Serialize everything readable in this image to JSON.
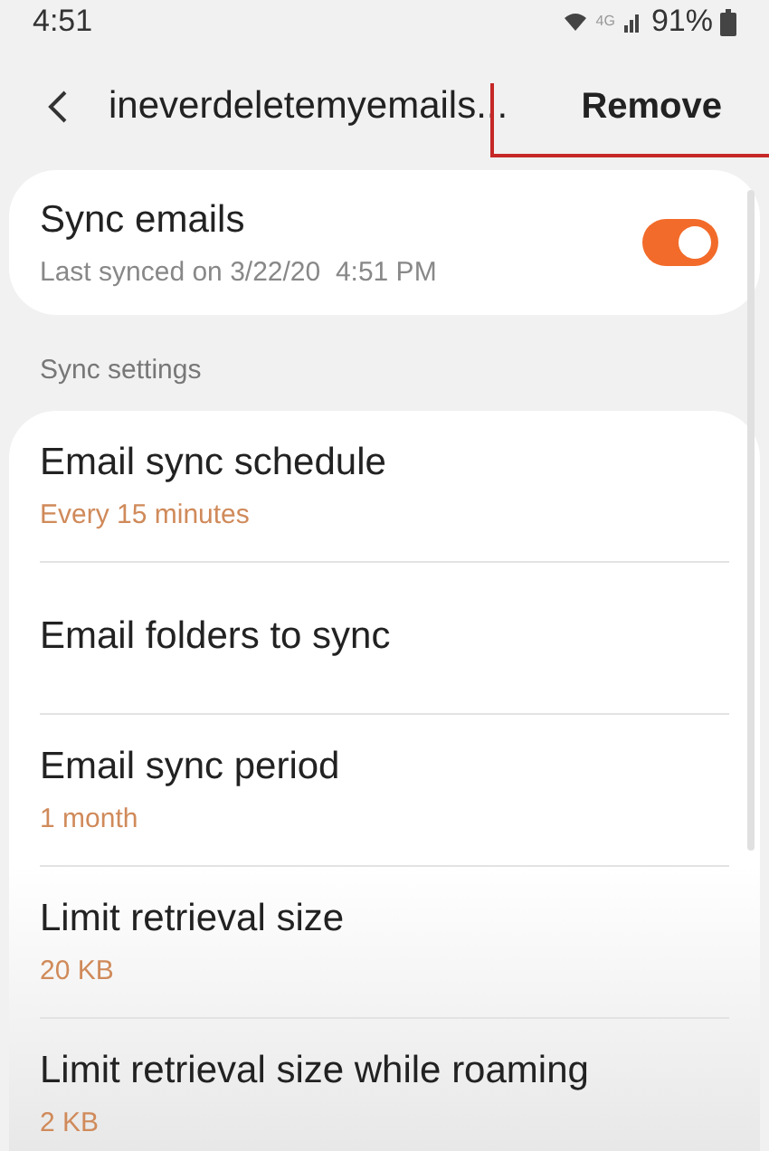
{
  "status_bar": {
    "time": "4:51",
    "network": "4G",
    "battery": "91%"
  },
  "header": {
    "title": "ineverdeletemyemails...",
    "action": "Remove"
  },
  "sync_card": {
    "title": "Sync emails",
    "subtitle": "Last synced on 3/22/20  4:51 PM",
    "on": true
  },
  "section_label": "Sync settings",
  "settings": [
    {
      "title": "Email sync schedule",
      "value": "Every 15 minutes"
    },
    {
      "title": "Email folders to sync"
    },
    {
      "title": "Email sync period",
      "value": "1 month"
    },
    {
      "title": "Limit retrieval size",
      "value": "20 KB"
    },
    {
      "title": "Limit retrieval size while roaming",
      "value": "2 KB"
    }
  ]
}
